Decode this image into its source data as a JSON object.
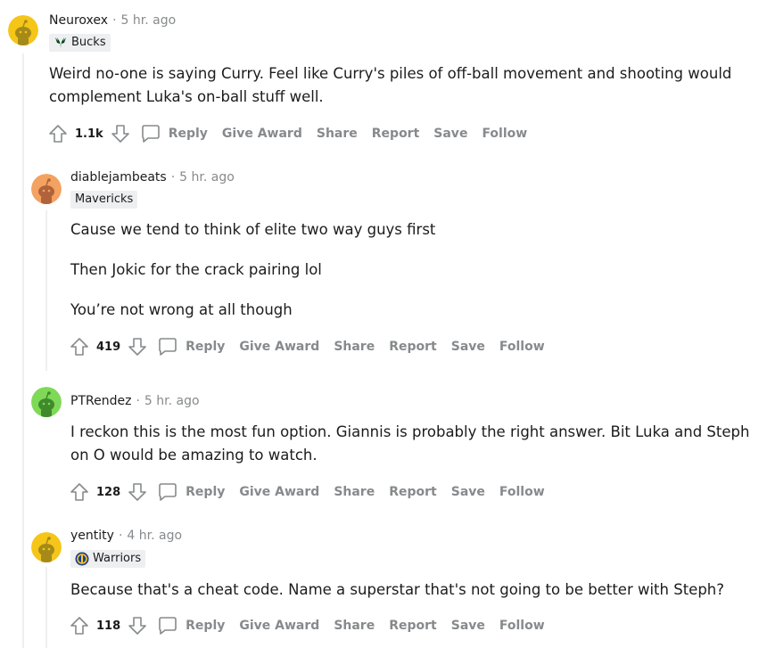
{
  "comments": [
    {
      "author": "Neuroxex",
      "time": "5 hr. ago",
      "flair": "Bucks",
      "flair_icon": "bucks-logo-icon",
      "avatar_color": "#f5c518",
      "paragraphs": [
        "Weird no-one is saying Curry. Feel like Curry's piles of off-ball movement and shooting would complement Luka's on-ball stuff well."
      ],
      "score": "1.1k"
    },
    {
      "author": "diablejambeats",
      "time": "5 hr. ago",
      "flair": "Mavericks",
      "avatar_color": "#f4a261",
      "paragraphs": [
        "Cause we tend to think of elite two way guys first",
        "Then Jokic for the crack pairing lol",
        "You’re not wrong at all though"
      ],
      "score": "419"
    },
    {
      "author": "PTRendez",
      "time": "5 hr. ago",
      "avatar_color": "#7ed957",
      "paragraphs": [
        "I reckon this is the most fun option. Giannis is probably the right answer. Bit Luka and Steph on O would be amazing to watch."
      ],
      "score": "128"
    },
    {
      "author": "yentity",
      "time": "4 hr. ago",
      "flair": "Warriors",
      "flair_icon": "warriors-logo-icon",
      "avatar_color": "#f5c518",
      "paragraphs": [
        "Because that's a cheat code. Name a superstar that's not going to be better with Steph?"
      ],
      "score": "118"
    }
  ],
  "actions": {
    "reply": "Reply",
    "give_award": "Give Award",
    "share": "Share",
    "report": "Report",
    "save": "Save",
    "follow": "Follow"
  },
  "separator": "·",
  "colors": {
    "meta_gray": "#878a8c",
    "flair_bg": "#edeff1",
    "thread_line": "#edeff1"
  }
}
